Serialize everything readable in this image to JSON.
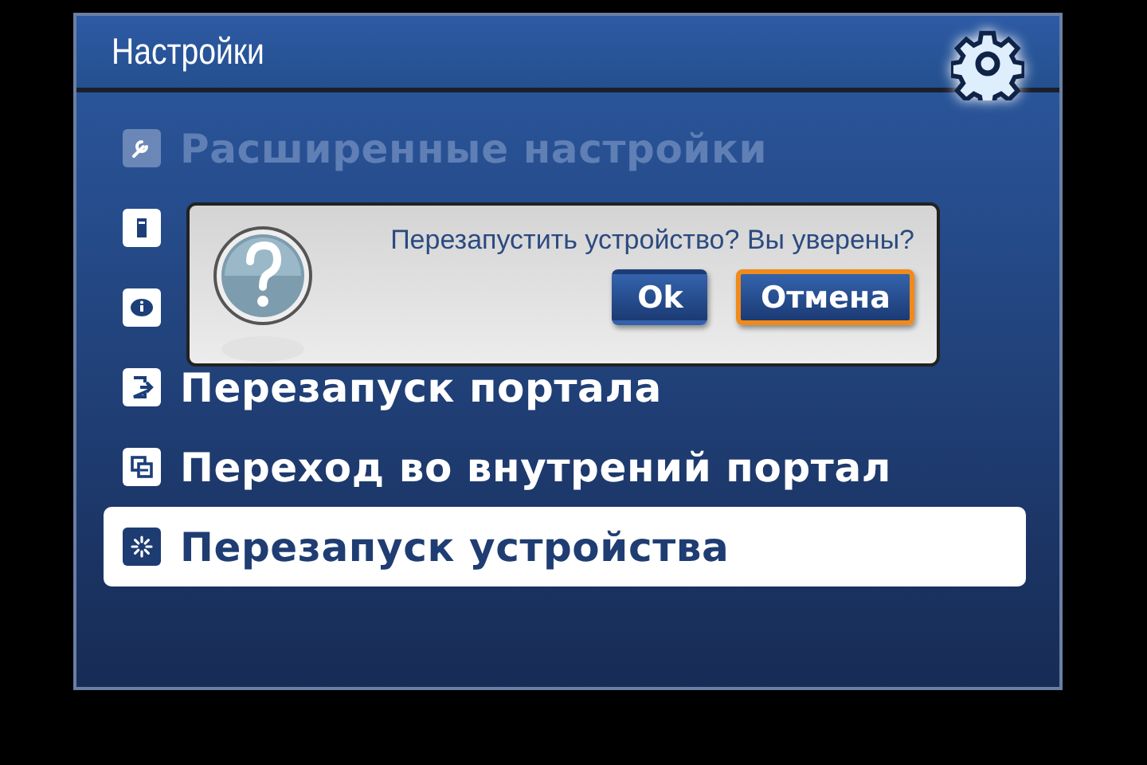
{
  "header": {
    "title": "Настройки"
  },
  "menu": [
    {
      "kind": "wrench",
      "label": "Расширенные настройки",
      "disabled": true,
      "selected": false
    },
    {
      "kind": "device",
      "disabled": false,
      "selected": false
    },
    {
      "kind": "info",
      "disabled": false,
      "selected": false
    },
    {
      "kind": "exit",
      "label": "Перезапуск портала",
      "disabled": false,
      "selected": false
    },
    {
      "kind": "switch",
      "label": "Переход во внутрений портал",
      "disabled": false,
      "selected": false
    },
    {
      "kind": "restart",
      "label": "Перезапуск устройства",
      "disabled": false,
      "selected": true
    }
  ],
  "dialog": {
    "message": "Перезапустить устройство? Вы уверены?",
    "buttons": [
      {
        "label": "Ok",
        "selected": false
      },
      {
        "label": "Отмена",
        "selected": true
      }
    ]
  }
}
